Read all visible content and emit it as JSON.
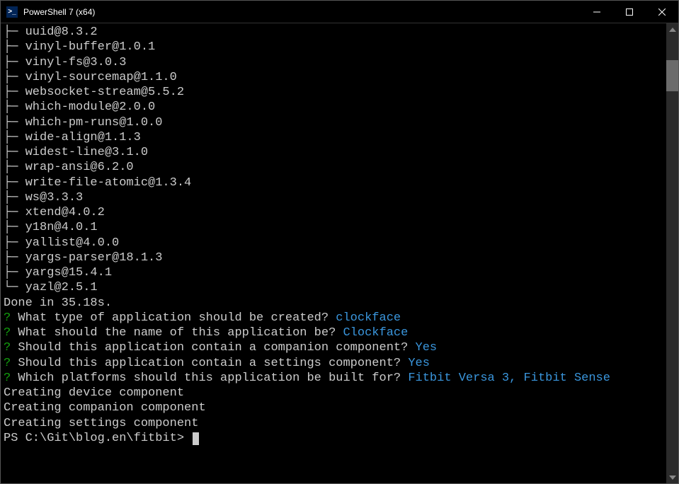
{
  "titlebar": {
    "icon_text": ">_",
    "title": "PowerShell 7 (x64)"
  },
  "packages": [
    "uuid@8.3.2",
    "vinyl-buffer@1.0.1",
    "vinyl-fs@3.0.3",
    "vinyl-sourcemap@1.1.0",
    "websocket-stream@5.5.2",
    "which-module@2.0.0",
    "which-pm-runs@1.0.0",
    "wide-align@1.1.3",
    "widest-line@3.1.0",
    "wrap-ansi@6.2.0",
    "write-file-atomic@1.3.4",
    "ws@3.3.3",
    "xtend@4.0.2",
    "y18n@4.0.1",
    "yallist@4.0.0",
    "yargs-parser@18.1.3",
    "yargs@15.4.1",
    "yazl@2.5.1"
  ],
  "done_line": "Done in 35.18s.",
  "prompts": [
    {
      "q": "What type of application should be created?",
      "a": "clockface"
    },
    {
      "q": "What should the name of this application be?",
      "a": "Clockface"
    },
    {
      "q": "Should this application contain a companion component?",
      "a": "Yes"
    },
    {
      "q": "Should this application contain a settings component?",
      "a": "Yes"
    },
    {
      "q": "Which platforms should this application be built for?",
      "a": "Fitbit Versa 3, Fitbit Sense"
    }
  ],
  "status_lines": [
    "Creating device component",
    "Creating companion component",
    "Creating settings component"
  ],
  "ps_prompt": "PS C:\\Git\\blog.en\\fitbit> ",
  "question_mark": "?",
  "tree_prefix_mid": "├─ ",
  "tree_prefix_last": "└─ "
}
